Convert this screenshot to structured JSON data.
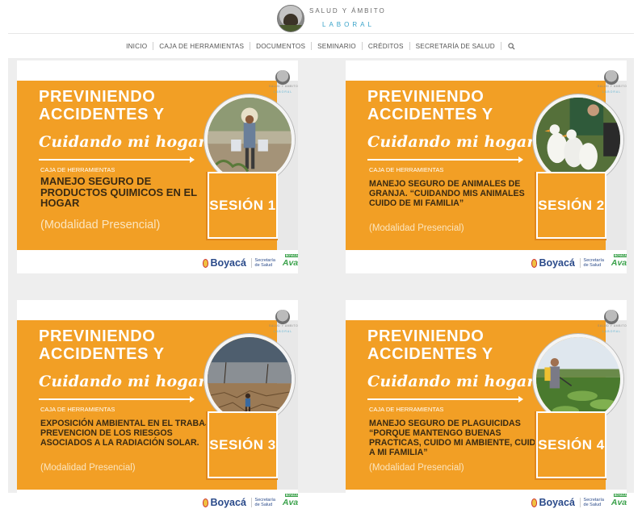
{
  "site": {
    "title_line1": "SALUD Y ÁMBITO",
    "title_line2": "LABORAL"
  },
  "nav": {
    "items": [
      "INICIO",
      "CAJA DE HERRAMIENTAS",
      "DOCUMENTOS",
      "SEMINARIO",
      "CRÉDITOS",
      "SECRETARÍA DE SALUD"
    ],
    "search_icon": "search-icon"
  },
  "cards": [
    {
      "line1": "PREVINIENDO",
      "line2": "ACCIDENTES Y",
      "script": "Cuidando mi hogar",
      "caja": "CAJA DE HERRAMIENTAS",
      "description": "MANEJO SEGURO DE PRODUCTOS QUIMICOS EN EL HOGAR",
      "session": "SESIÓN 1",
      "modality": "(Modalidad Presencial)",
      "photo": "farmer-carrying-buckets",
      "footer": {
        "brand": "Boyacá",
        "secretaria": "Secretaría de Salud",
        "avanza": "Avanza",
        "avanza_tag": "BOYACÁ"
      }
    },
    {
      "line1": "PREVINIENDO",
      "line2": "ACCIDENTES Y",
      "script": "Cuidando mi hogar",
      "caja": "CAJA DE HERRAMIENTAS",
      "description": "MANEJO SEGURO DE ANIMALES DE GRANJA. “CUIDANDO MIS ANIMALES CUIDO DE MI FAMILIA”",
      "session": "SESIÓN 2",
      "modality": "(Modalidad Presencial)",
      "photo": "geese-and-farmer",
      "footer": {
        "brand": "Boyacá",
        "secretaria": "Secretaría de Salud",
        "avanza": "Avanza",
        "avanza_tag": "BOYACÁ"
      }
    },
    {
      "line1": "PREVINIENDO",
      "line2": "ACCIDENTES Y",
      "script": "Cuidando mi hogar",
      "caja": "CAJA DE HERRAMIENTAS",
      "description": "EXPOSICIÓN AMBIENTAL EN EL TRABAJO. PREVENCION DE LOS RIESGOS ASOCIADOS A LA RADIACIÓN SOLAR.",
      "session": "SESIÓN 3",
      "modality": "(Modalidad Presencial)",
      "photo": "child-in-drought",
      "footer": {
        "brand": "Boyacá",
        "secretaria": "Secretaría de Salud",
        "avanza": "Avanza",
        "avanza_tag": "BOYACÁ"
      }
    },
    {
      "line1": "PREVINIENDO",
      "line2": "ACCIDENTES Y",
      "script": "Cuidando mi hogar",
      "caja": "CAJA DE HERRAMIENTAS",
      "description": "MANEJO SEGURO DE PLAGUICIDAS “PORQUE MANTENGO BUENAS PRACTICAS, CUIDO MI AMBIENTE, CUIDO A MI FAMILIA”",
      "session": "SESIÓN 4",
      "modality": "(Modalidad Presencial)",
      "photo": "farmer-spraying-crops",
      "footer": {
        "brand": "Boyacá",
        "secretaria": "Secretaría de Salud",
        "avanza": "Avanza",
        "avanza_tag": "BOYACÁ"
      }
    }
  ],
  "colors": {
    "accent": "#f29f25",
    "link": "#39a3c9",
    "dark_text": "#3a2a12"
  }
}
